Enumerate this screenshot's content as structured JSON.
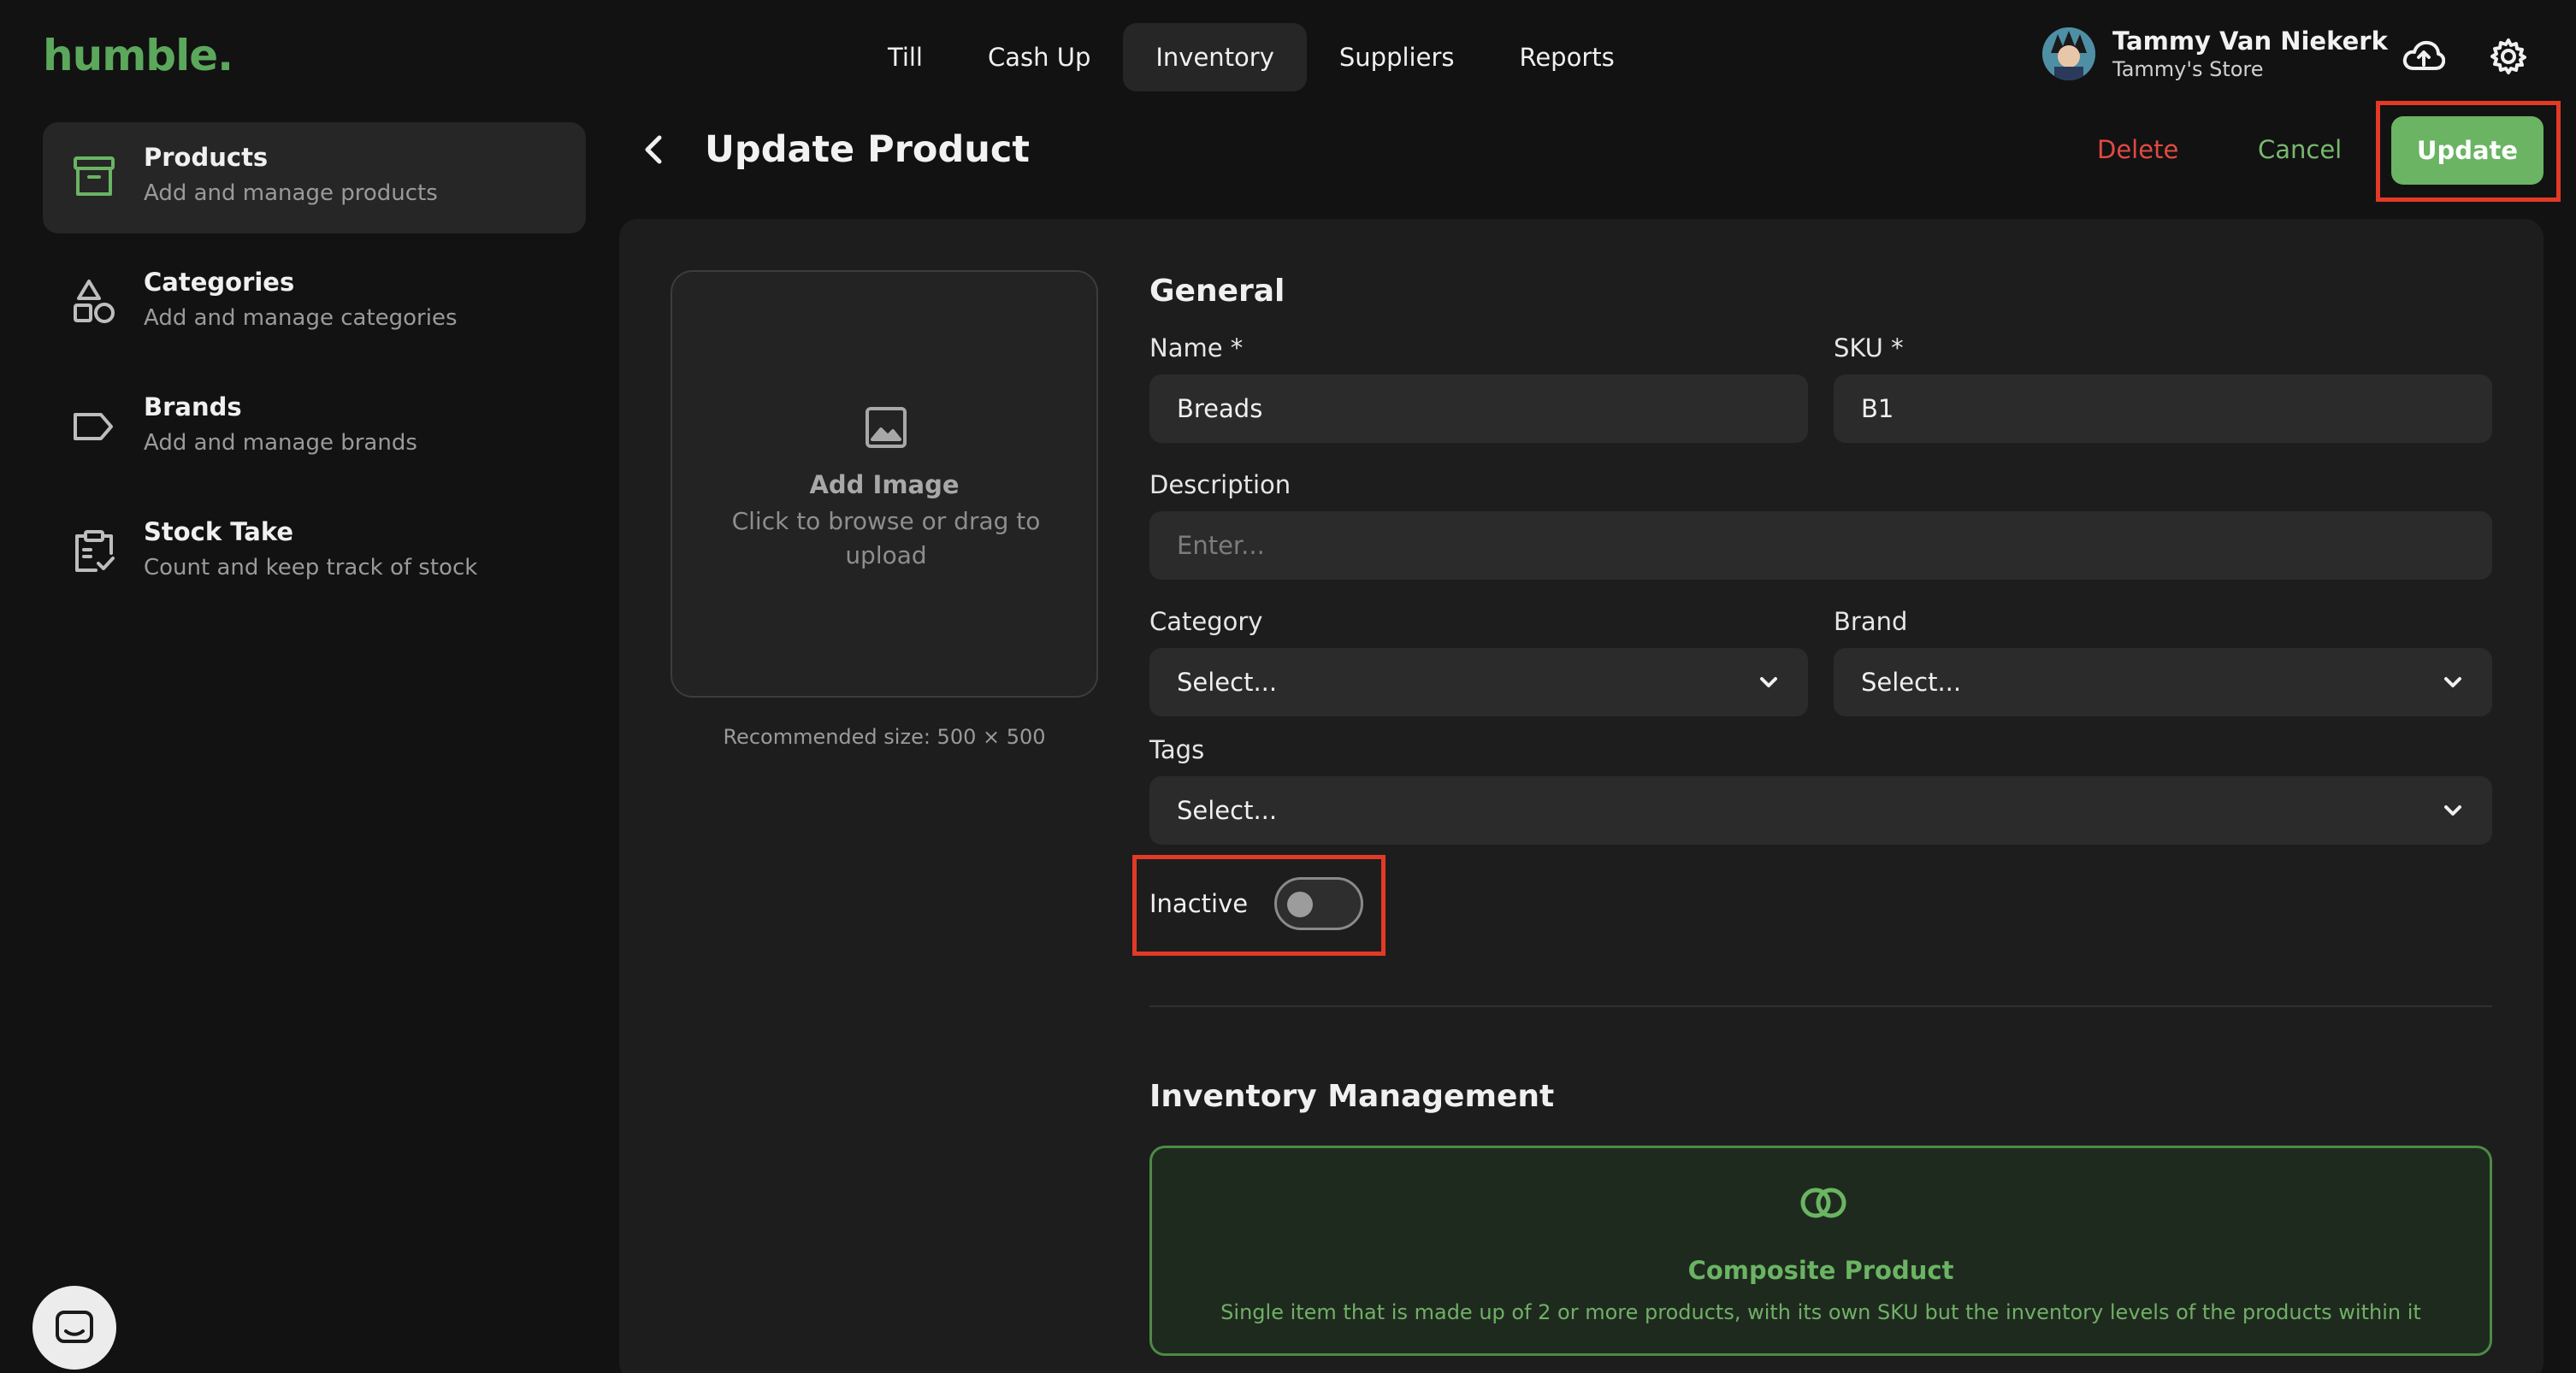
{
  "app": {
    "logo": "humble."
  },
  "nav": {
    "items": [
      {
        "label": "Till"
      },
      {
        "label": "Cash Up"
      },
      {
        "label": "Inventory"
      },
      {
        "label": "Suppliers"
      },
      {
        "label": "Reports"
      }
    ],
    "active": "Inventory"
  },
  "user": {
    "name": "Tammy Van Niekerk",
    "store": "Tammy's Store"
  },
  "sidebar": {
    "items": [
      {
        "title": "Products",
        "subtitle": "Add and manage products",
        "icon": "archive-box-icon"
      },
      {
        "title": "Categories",
        "subtitle": "Add and manage categories",
        "icon": "shapes-icon"
      },
      {
        "title": "Brands",
        "subtitle": "Add and manage brands",
        "icon": "tag-icon"
      },
      {
        "title": "Stock Take",
        "subtitle": "Count and keep track of stock",
        "icon": "clipboard-check-icon"
      }
    ]
  },
  "header": {
    "title": "Update Product",
    "delete_label": "Delete",
    "cancel_label": "Cancel",
    "update_label": "Update"
  },
  "image": {
    "title": "Add Image",
    "subtitle": "Click to browse or drag to upload",
    "recommended": "Recommended size: 500 × 500"
  },
  "general": {
    "title": "General",
    "name": {
      "label": "Name *",
      "value": "Breads"
    },
    "sku": {
      "label": "SKU *",
      "value": "B1"
    },
    "description": {
      "label": "Description",
      "placeholder": "Enter..."
    },
    "category": {
      "label": "Category",
      "value": "Select..."
    },
    "brand": {
      "label": "Brand",
      "value": "Select..."
    },
    "tags": {
      "label": "Tags",
      "value": "Select..."
    },
    "inactive": {
      "label": "Inactive",
      "on": false
    }
  },
  "inventory": {
    "title": "Inventory Management",
    "composite": {
      "title": "Composite Product",
      "subtitle": "Single item that is made up of 2 or more products, with its own SKU but the inventory levels of the products within it"
    }
  },
  "colors": {
    "accent": "#6ab463",
    "danger": "#e24a43",
    "highlight": "#e23a26",
    "background": "#121212",
    "panel": "#1d1d1d"
  }
}
